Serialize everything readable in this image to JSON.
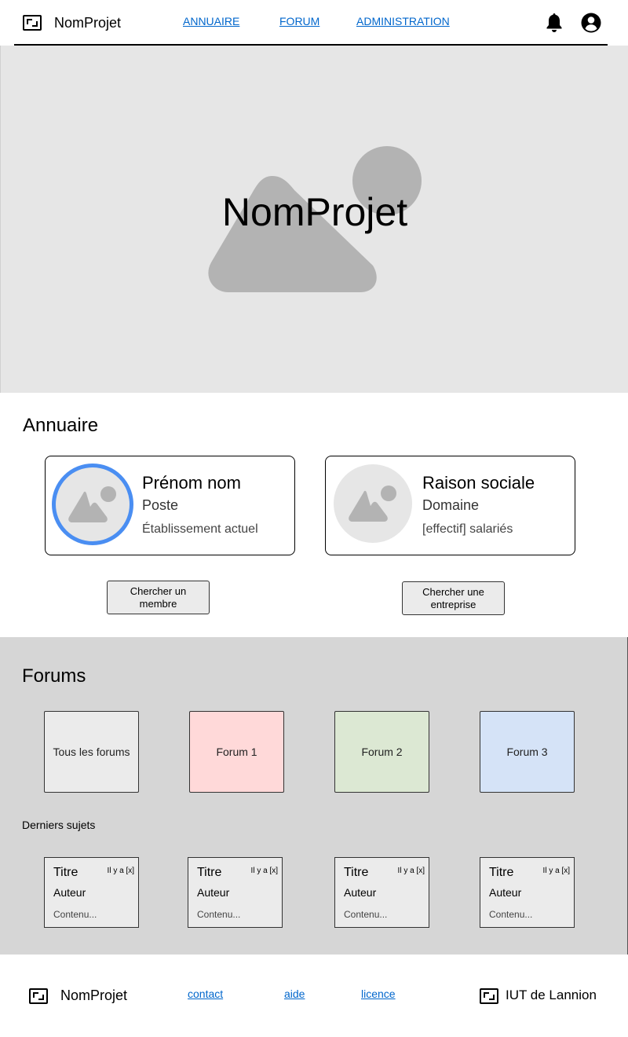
{
  "header": {
    "brand": "NomProjet",
    "nav": [
      "ANNUAIRE",
      "FORUM",
      "ADMINISTRATION"
    ]
  },
  "hero": {
    "title": "NomProjet"
  },
  "annuaire": {
    "title": "Annuaire",
    "member_card": {
      "name": "Prénom nom",
      "role": "Poste",
      "place": "Établissement actuel"
    },
    "company_card": {
      "name": "Raison sociale",
      "domain": "Domaine",
      "staff": "[effectif] salariés"
    },
    "member_button": "Chercher un membre",
    "company_button": "Chercher une entreprise"
  },
  "forums": {
    "title": "Forums",
    "tiles": [
      {
        "label": "Tous les forums",
        "color": "#ebebeb"
      },
      {
        "label": "Forum 1",
        "color": "#ffd9d9"
      },
      {
        "label": "Forum 2",
        "color": "#dce8d3"
      },
      {
        "label": "Forum 3",
        "color": "#d5e3f7"
      }
    ],
    "latest_label": "Derniers sujets",
    "topics": [
      {
        "title": "Titre",
        "ago": "Il y a [x]",
        "author": "Auteur",
        "content": "Contenu..."
      },
      {
        "title": "Titre",
        "ago": "Il y a [x]",
        "author": "Auteur",
        "content": "Contenu..."
      },
      {
        "title": "Titre",
        "ago": "Il y a [x]",
        "author": "Auteur",
        "content": "Contenu..."
      },
      {
        "title": "Titre",
        "ago": "Il y a [x]",
        "author": "Auteur",
        "content": "Contenu..."
      }
    ]
  },
  "footer": {
    "brand": "NomProjet",
    "links": [
      "contact",
      "aide",
      "licence"
    ],
    "institution": "IUT de Lannion"
  },
  "icons": {
    "logo": "logo-icon",
    "bell": "bell-icon",
    "account": "account-icon",
    "image_placeholder": "image-placeholder-icon"
  },
  "colors": {
    "accent_ring": "#4a8ef2",
    "link": "#0066cc"
  }
}
